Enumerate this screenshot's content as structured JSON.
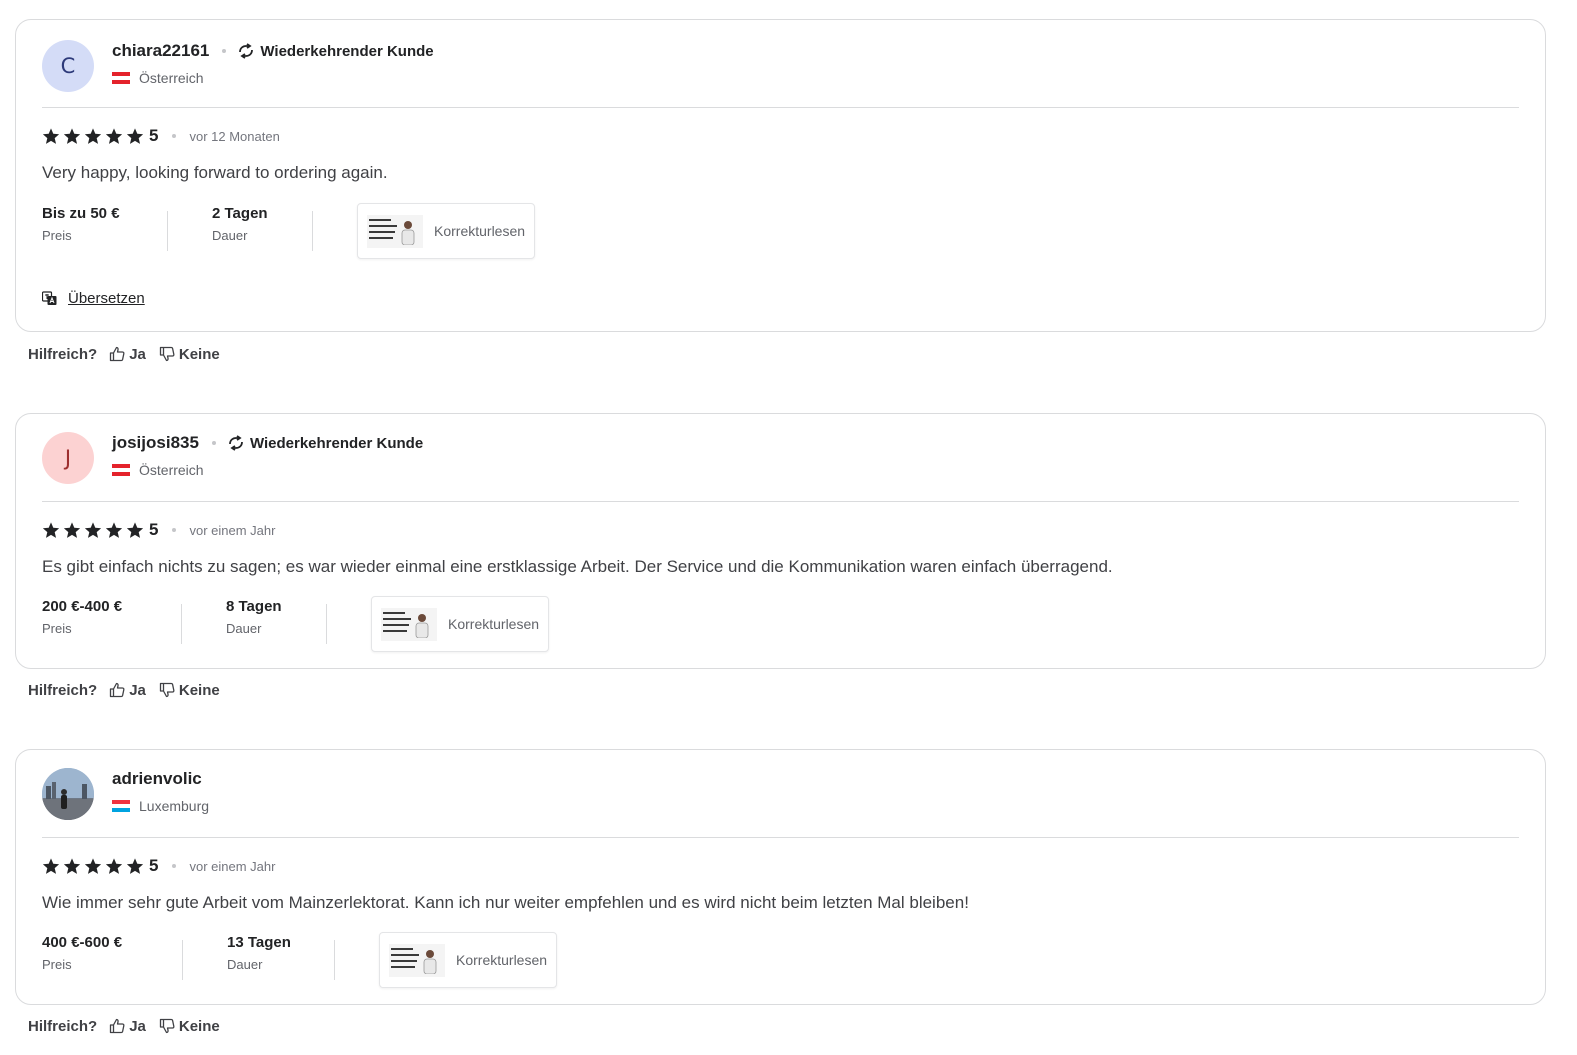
{
  "reviews": [
    {
      "avatar_letter": "C",
      "username": "chiara22161",
      "repeat_label": "Wiederkehrender Kunde",
      "country": "Österreich",
      "flag": [
        "#e4222b",
        "#ffffff",
        "#e4222b"
      ],
      "score": "5",
      "time": "vor 12 Monaten",
      "text": "Very happy, looking forward to ordering again.",
      "price_value": "Bis zu 50 €",
      "price_label": "Preis",
      "duration_value": "2 Tagen",
      "duration_label": "Dauer",
      "gig_label": "Korrekturlesen",
      "translate_label": "Übersetzen"
    },
    {
      "avatar_letter": "J",
      "username": "josijosi835",
      "repeat_label": "Wiederkehrender Kunde",
      "country": "Österreich",
      "flag": [
        "#e4222b",
        "#ffffff",
        "#e4222b"
      ],
      "score": "5",
      "time": "vor einem Jahr",
      "text": "Es gibt einfach nichts zu sagen; es war wieder einmal eine erstklassige Arbeit. Der Service und die Kommunikation waren einfach überragend.",
      "price_value": "200 €-400 €",
      "price_label": "Preis",
      "duration_value": "8 Tagen",
      "duration_label": "Dauer",
      "gig_label": "Korrekturlesen"
    },
    {
      "avatar_letter": "",
      "username": "adrienvolic",
      "country": "Luxemburg",
      "flag": [
        "#ef3340",
        "#ffffff",
        "#00a3e0"
      ],
      "score": "5",
      "time": "vor einem Jahr",
      "text": "Wie immer sehr gute Arbeit vom Mainzerlektorat. Kann ich nur weiter empfehlen und es wird nicht beim letzten Mal bleiben!",
      "price_value": "400 €-600 €",
      "price_label": "Preis",
      "duration_value": "13 Tagen",
      "duration_label": "Dauer",
      "gig_label": "Korrekturlesen"
    }
  ],
  "helpful": {
    "label": "Hilfreich?",
    "yes": "Ja",
    "no": "Keine"
  },
  "colors": {
    "border": "#dadbdd",
    "text": "#222325",
    "muted": "#62646a",
    "star": "#222325"
  },
  "icons": {
    "repeat": "repeat-icon",
    "star": "star-icon",
    "thumbs_up": "thumbs-up-icon",
    "thumbs_down": "thumbs-down-icon",
    "translate": "translate-icon"
  }
}
